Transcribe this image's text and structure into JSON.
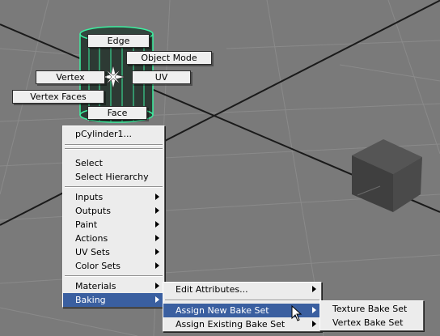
{
  "marking_menu": {
    "edge": "Edge",
    "object_mode": "Object Mode",
    "vertex": "Vertex",
    "uv": "UV",
    "vertex_faces": "Vertex Faces",
    "face": "Face"
  },
  "context_menu": {
    "title": "pCylinder1...",
    "select": "Select",
    "select_hierarchy": "Select Hierarchy",
    "inputs": "Inputs",
    "outputs": "Outputs",
    "paint": "Paint",
    "actions": "Actions",
    "uv_sets": "UV Sets",
    "color_sets": "Color Sets",
    "materials": "Materials",
    "baking": "Baking"
  },
  "baking_submenu": {
    "edit_attributes": "Edit Attributes...",
    "assign_new_bake_set": "Assign New Bake Set",
    "assign_existing_bake_set": "Assign Existing Bake Set"
  },
  "bake_set_submenu": {
    "texture_bake_set": "Texture Bake Set",
    "vertex_bake_set": "Vertex Bake Set"
  },
  "colors": {
    "viewport_bg": "#7a7a7a",
    "menu_highlight": "#3a5fa0",
    "wireframe_selected": "#3cf0a0"
  }
}
